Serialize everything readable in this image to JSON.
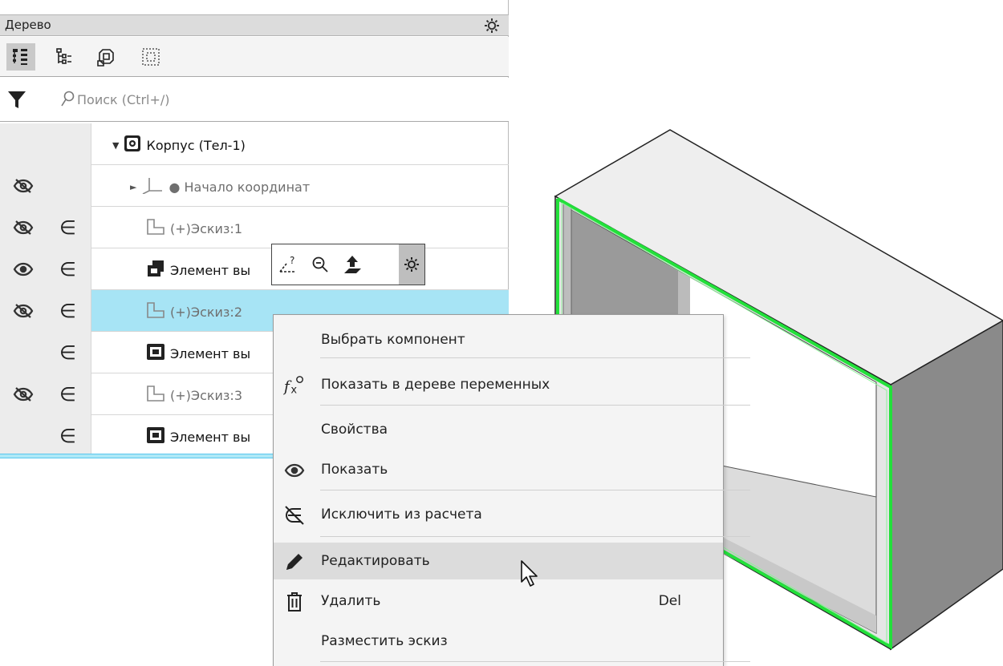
{
  "panel": {
    "title": "Дерево",
    "search_placeholder": "Поиск (Ctrl+/)"
  },
  "toolbar": {
    "buttons": [
      "tree-structure-icon",
      "tree-list-icon",
      "component-icon",
      "select-frame-icon"
    ]
  },
  "tree": {
    "rows": [
      {
        "label": "Корпус (Тел-1)",
        "eye": "",
        "excluded": false
      },
      {
        "label": "● Начало координат",
        "eye": "hidden",
        "excluded": false
      },
      {
        "label": "(+)Эскиз:1",
        "eye": "hidden",
        "excluded": true
      },
      {
        "label": "Элемент вы",
        "eye": "visible",
        "excluded": true
      },
      {
        "label": "(+)Эскиз:2",
        "eye": "hidden",
        "excluded": true
      },
      {
        "label": "Элемент вы",
        "eye": "",
        "excluded": true
      },
      {
        "label": "(+)Эскиз:3",
        "eye": "hidden",
        "excluded": true
      },
      {
        "label": "Элемент вы",
        "eye": "",
        "excluded": true
      }
    ],
    "exclude_symbol": "∈"
  },
  "menu": {
    "items": [
      {
        "label": "Выбрать компонент",
        "icon": ""
      },
      {
        "label": "Показать в дереве переменных",
        "icon": "fx-icon"
      },
      {
        "label": "Свойства",
        "icon": ""
      },
      {
        "label": "Показать",
        "icon": "eye-icon"
      },
      {
        "label": "Исключить из расчета",
        "icon": "exclude-icon"
      },
      {
        "label": "Редактировать",
        "icon": "pencil-icon"
      },
      {
        "label": "Удалить",
        "icon": "trash-icon",
        "shortcut": "Del"
      },
      {
        "label": "Разместить эскиз",
        "icon": ""
      }
    ]
  },
  "colors": {
    "selection": "#a7e4f5",
    "highlight_edge": "#22e03a",
    "menu_hover": "#dcdcdc"
  }
}
